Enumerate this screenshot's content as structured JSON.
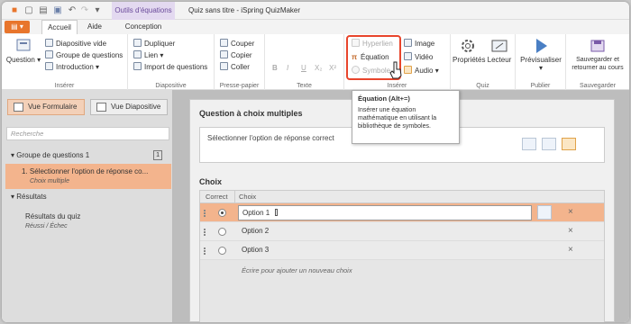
{
  "window": {
    "title": "Quiz sans titre - iSpring QuizMaker",
    "context_tab": "Outils d'équations"
  },
  "tabs": [
    "Accueil",
    "Aide",
    "Conception"
  ],
  "ribbon": {
    "insert1": {
      "question": "Question",
      "items": [
        "Diapositive vide",
        "Groupe de questions",
        "Introduction"
      ],
      "label": "Insérer"
    },
    "slide": {
      "items": [
        "Dupliquer",
        "Lien",
        "Import de questions"
      ],
      "label": "Diapositive"
    },
    "clipboard": {
      "items": [
        "Couper",
        "Copier",
        "Coller"
      ],
      "label": "Presse-papier"
    },
    "text": {
      "buttons": [
        "B",
        "I",
        "U",
        "X₂",
        "X²"
      ],
      "label": "Texte"
    },
    "insert2": {
      "items": [
        "Hyperlien",
        "Équation",
        "Symbole",
        "Image",
        "Vidéo",
        "Audio"
      ],
      "label": "Insérer"
    },
    "quiz": {
      "items": [
        "Propriétés",
        "Lecteur"
      ],
      "label": "Quiz"
    },
    "publish": {
      "item": "Prévisualiser",
      "label": "Publier"
    },
    "save": {
      "item": "Sauvegarder et retourner au cours",
      "label": "Sauvegarder"
    }
  },
  "tooltip": {
    "title": "Équation (Alt+=)",
    "body": "Insérer une équation mathématique en utilisant la bibliothèque de symboles."
  },
  "left": {
    "view_form": "Vue Formulaire",
    "view_slide": "Vue Diapositive",
    "search_placeholder": "Recherche",
    "group": "Groupe de questions 1",
    "group_count": "1",
    "item": "1. Sélectionner l'option de réponse co...",
    "item_sub": "Choix multiple",
    "results": "Résultats",
    "results_item": "Résultats du quiz",
    "results_sub": "Réussi / Échec"
  },
  "main": {
    "question_type": "Question à choix multiples",
    "question_text": "Sélectionner l'option de réponse correct",
    "choices_label": "Choix",
    "col_correct": "Correct",
    "col_choice": "Choix",
    "options": [
      "Option 1",
      "Option 2",
      "Option 3"
    ],
    "add_placeholder": "Écrire pour ajouter un nouveau choix"
  },
  "colors": {
    "accent": "#e8752c",
    "highlight": "#e8452c",
    "selected_row": "#f3b48d"
  }
}
